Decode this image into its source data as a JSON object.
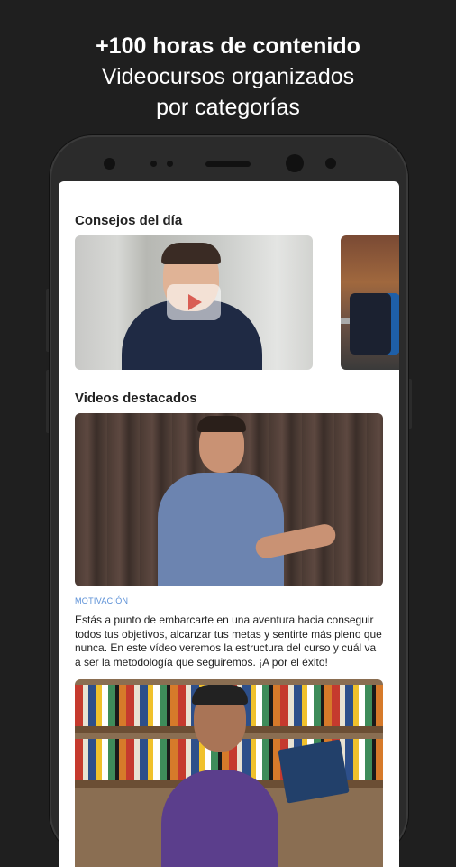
{
  "promo": {
    "line1": "+100 horas de contenido",
    "line2": "Videocursos organizados",
    "line3": "por categorías"
  },
  "app": {
    "tips_section_title": "Consejos del día",
    "featured_section_title": "Videos destacados",
    "featured_video": {
      "category": "MOTIVACIÓN",
      "description": "Estás a punto de embarcarte en una aventura hacia conseguir todos tus objetivos, alcanzar tus metas y sentirte más pleno que nunca. En este vídeo veremos la estructura del curso y cuál va a ser la metodología que seguiremos. ¡A por el éxito!"
    }
  },
  "colors": {
    "background": "#1f1f1f",
    "category_accent": "#5a8fd6"
  }
}
